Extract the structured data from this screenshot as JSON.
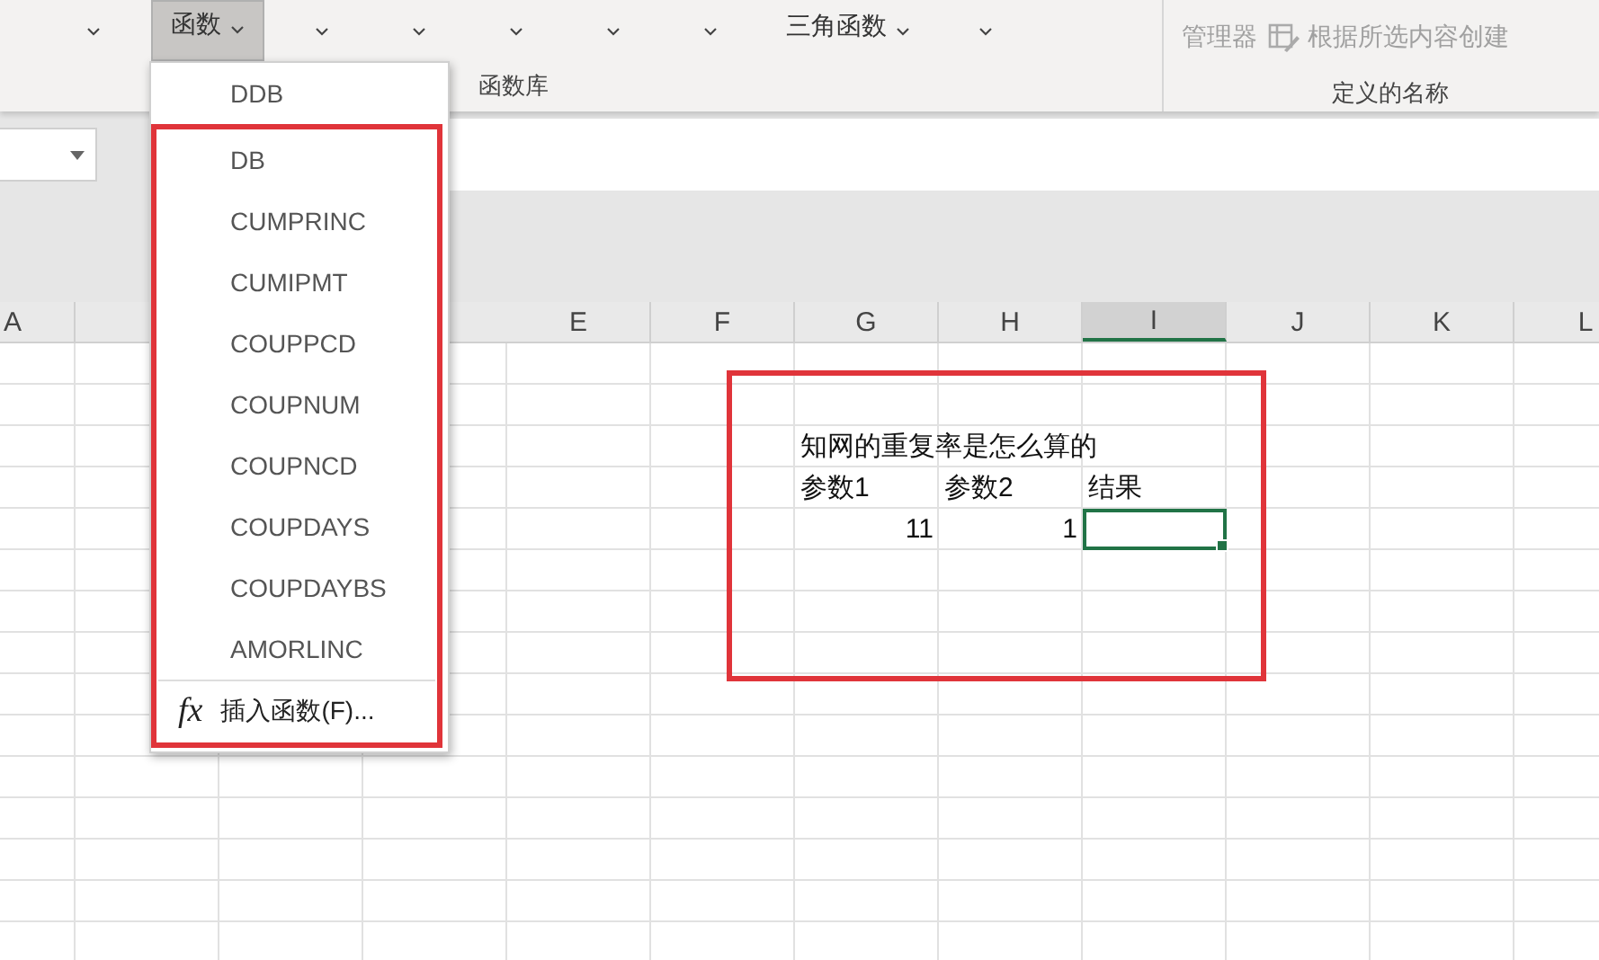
{
  "ribbon": {
    "buttons": [
      {
        "kind": "chevron",
        "selected": false
      },
      {
        "kind": "labeled",
        "label": "函数",
        "selected": true
      },
      {
        "kind": "chevron",
        "selected": false
      },
      {
        "kind": "chevron",
        "selected": false
      },
      {
        "kind": "chevron",
        "selected": false
      },
      {
        "kind": "chevron",
        "selected": false
      },
      {
        "kind": "chevron",
        "selected": false
      },
      {
        "kind": "labeled",
        "label": "三角函数",
        "selected": false
      },
      {
        "kind": "chevron",
        "selected": false
      }
    ],
    "group_label": "函数库",
    "name_manager": "管理器",
    "create_from_selection": "根据所选内容创建",
    "names_group_label": "定义的名称"
  },
  "function_menu": {
    "first_item": "DDB",
    "items": [
      "DB",
      "CUMPRINC",
      "CUMIPMT",
      "COUPPCD",
      "COUPNUM",
      "COUPNCD",
      "COUPDAYS",
      "COUPDAYBS",
      "AMORLINC"
    ],
    "insert_function_icon": "fx",
    "insert_function": "插入函数(F)..."
  },
  "sheet": {
    "first_column": {
      "label": "A",
      "selected": false
    },
    "columns": [
      {
        "label": "E",
        "selected": false
      },
      {
        "label": "F",
        "selected": false
      },
      {
        "label": "G",
        "selected": false
      },
      {
        "label": "H",
        "selected": false
      },
      {
        "label": "I",
        "selected": true
      },
      {
        "label": "J",
        "selected": false
      },
      {
        "label": "K",
        "selected": false
      },
      {
        "label": "L",
        "selected": false
      }
    ],
    "rows": [
      {
        "cells": [
          {
            "selected": false
          },
          {
            "selected": false
          },
          {
            "selected": false
          },
          {
            "selected": false
          },
          {
            "selected": false
          },
          {
            "selected": false
          },
          {
            "selected": false
          },
          {
            "selected": false
          }
        ]
      },
      {
        "cells": [
          {
            "selected": false
          },
          {
            "selected": false
          },
          {
            "selected": false
          },
          {
            "selected": false
          },
          {
            "selected": false
          },
          {
            "selected": false
          },
          {
            "selected": false
          },
          {
            "selected": false
          }
        ]
      },
      {
        "cells": [
          {
            "selected": false
          },
          {
            "selected": false
          },
          {
            "kind": "text",
            "text": "知网的重复率是怎么算的",
            "selected": false
          },
          {
            "selected": false
          },
          {
            "selected": false
          },
          {
            "selected": false
          },
          {
            "selected": false
          },
          {
            "selected": false
          }
        ]
      },
      {
        "cells": [
          {
            "selected": false
          },
          {
            "selected": false
          },
          {
            "kind": "text",
            "text": "参数1",
            "selected": false
          },
          {
            "kind": "text",
            "text": "参数2",
            "selected": false
          },
          {
            "kind": "text",
            "text": "结果",
            "selected": false
          },
          {
            "selected": false
          },
          {
            "selected": false
          },
          {
            "selected": false
          }
        ]
      },
      {
        "cells": [
          {
            "selected": false
          },
          {
            "selected": false
          },
          {
            "kind": "number",
            "text": "11",
            "selected": false
          },
          {
            "kind": "number",
            "text": "1",
            "selected": false
          },
          {
            "selected": true
          },
          {
            "selected": false
          },
          {
            "selected": false
          },
          {
            "selected": false
          }
        ]
      }
    ]
  }
}
